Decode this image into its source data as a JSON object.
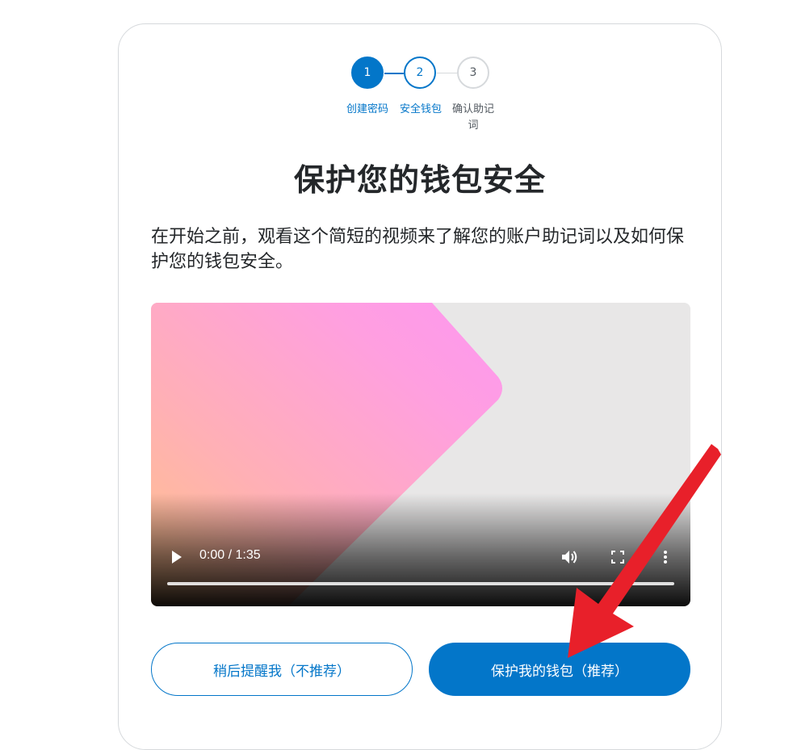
{
  "stepper": {
    "steps": [
      {
        "number": "1",
        "label": "创建密码",
        "state": "complete"
      },
      {
        "number": "2",
        "label": "安全钱包",
        "state": "active"
      },
      {
        "number": "3",
        "label": "确认助记词",
        "state": "upcoming"
      }
    ],
    "step3_label_line1": "确认助记",
    "step3_label_line2": "词"
  },
  "title": "保护您的钱包安全",
  "description": "在开始之前，观看这个简短的视频来了解您的账户助记词以及如何保护您的钱包安全。",
  "video": {
    "time": "0:00 / 1:35",
    "progress": 0
  },
  "buttons": {
    "remind_later": "稍后提醒我（不推荐）",
    "secure_wallet": "保护我的钱包（推荐）"
  },
  "colors": {
    "accent": "#0376c9",
    "annotation_arrow": "#e8202a"
  },
  "icons": [
    "play-icon",
    "volume-icon",
    "fullscreen-icon",
    "more-vertical-icon",
    "annotation-arrow"
  ]
}
